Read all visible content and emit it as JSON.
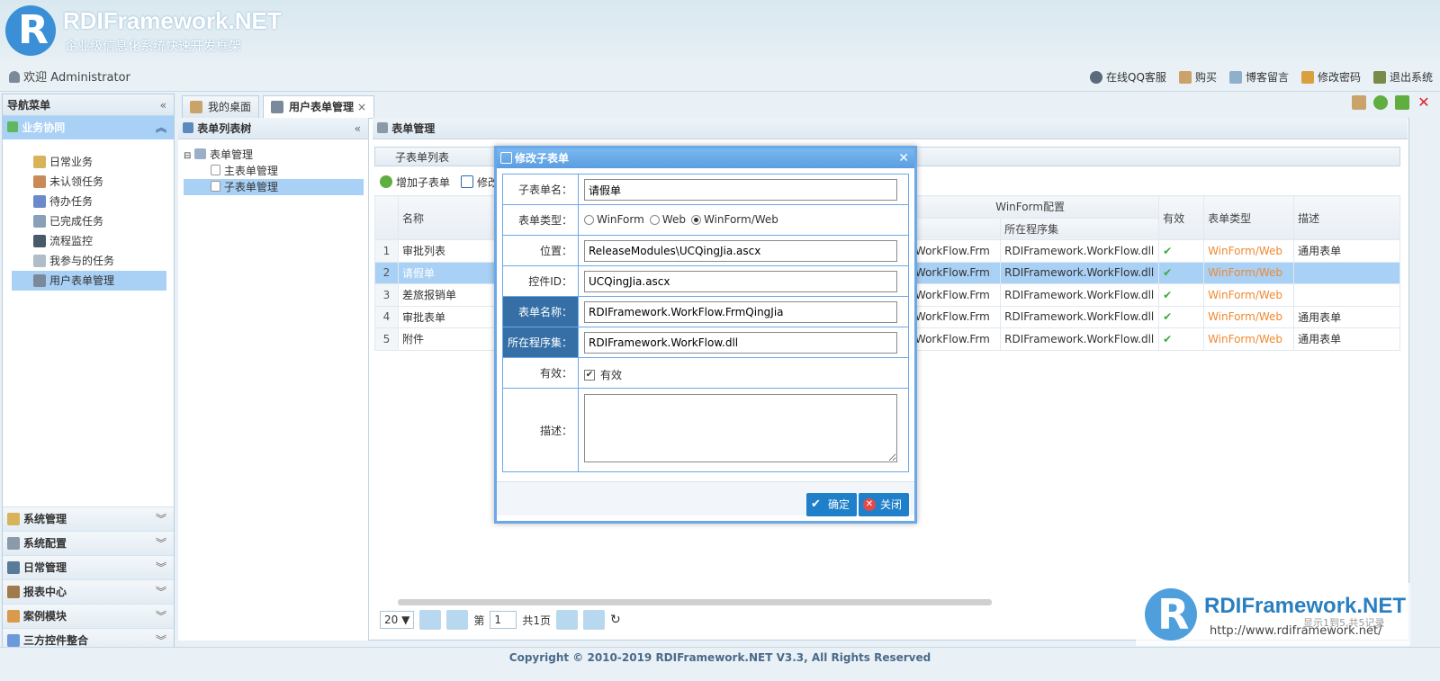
{
  "header": {
    "brand_title": "RDIFramework.NET",
    "brand_subtitle": "企业级信息化系统快速开发框架",
    "welcome": "欢迎 Administrator",
    "links": [
      "在线QQ客服",
      "购买",
      "博客留言",
      "修改密码",
      "退出系统"
    ]
  },
  "nav": {
    "title": "导航菜单",
    "active_group": "业务协同",
    "items": [
      "日常业务",
      "未认领任务",
      "待办任务",
      "已完成任务",
      "流程监控",
      "我参与的任务",
      "用户表单管理"
    ],
    "groups": [
      "系统管理",
      "系统配置",
      "日常管理",
      "报表中心",
      "案例模块",
      "三方控件整合"
    ]
  },
  "tabs": [
    "我的桌面",
    "用户表单管理"
  ],
  "tree": {
    "title": "表单列表树",
    "root": "表单管理",
    "children": [
      "主表单管理",
      "子表单管理"
    ]
  },
  "form_area": {
    "title": "表单管理",
    "sub_list_title": "子表单列表",
    "toolbar": [
      "增加子表单",
      "修改"
    ],
    "columns": {
      "name": "名称",
      "winform_group": "WinForm配置",
      "assembly": "所在程序集",
      "valid": "有效",
      "form_type": "表单类型",
      "desc": "描述"
    },
    "rows": [
      {
        "no": "1",
        "name": "审批列表",
        "formname": "k.WorkFlow.Frm",
        "assembly": "RDIFramework.WorkFlow.dll",
        "type": "WinForm/Web",
        "desc": "通用表单"
      },
      {
        "no": "2",
        "name": "请假单",
        "formname": "k.WorkFlow.Frm",
        "assembly": "RDIFramework.WorkFlow.dll",
        "type": "WinForm/Web",
        "desc": ""
      },
      {
        "no": "3",
        "name": "差旅报销单",
        "formname": "k.WorkFlow.Frm",
        "assembly": "RDIFramework.WorkFlow.dll",
        "type": "WinForm/Web",
        "desc": ""
      },
      {
        "no": "4",
        "name": "审批表单",
        "formname": "k.WorkFlow.Frm",
        "assembly": "RDIFramework.WorkFlow.dll",
        "type": "WinForm/Web",
        "desc": "通用表单"
      },
      {
        "no": "5",
        "name": "附件",
        "formname": "k.WorkFlow.Frm",
        "assembly": "RDIFramework.WorkFlow.dll",
        "type": "WinForm/Web",
        "desc": "通用表单"
      }
    ],
    "pager": {
      "page_size": "20 ▼",
      "page_label": "第",
      "page": "1",
      "total_pages": "共1页",
      "info": "显示1到5,共5记录"
    }
  },
  "dialog": {
    "title": "修改子表单",
    "fields": {
      "sub_name_label": "子表单名：",
      "sub_name": "请假单",
      "type_label": "表单类型：",
      "type_options": [
        "WinForm",
        "Web",
        "WinForm/Web"
      ],
      "type_selected": "WinForm/Web",
      "position_label": "位置：",
      "position": "ReleaseModules\\UCQingJia.ascx",
      "control_label": "控件ID：",
      "control": "UCQingJia.ascx",
      "form_name_label": "表单名称：",
      "form_name": "RDIFramework.WorkFlow.FrmQingJia",
      "assembly_label": "所在程序集：",
      "assembly": "RDIFramework.WorkFlow.dll",
      "valid_label": "有效：",
      "valid_text": "有效",
      "valid_checked": true,
      "desc_label": "描述：",
      "desc": ""
    },
    "ok_label": "确定",
    "close_label": "关闭"
  },
  "watermark": {
    "title": "RDIFramework.NET",
    "url": "http://www.rdiframework.net/"
  },
  "footer": "Copyright © 2010-2019 RDIFramework.NET V3.3, All Rights Reserved",
  "colors": {
    "accent": "#a9d0f5",
    "button": "#1f7fc9",
    "link_orange": "#f0892f"
  }
}
